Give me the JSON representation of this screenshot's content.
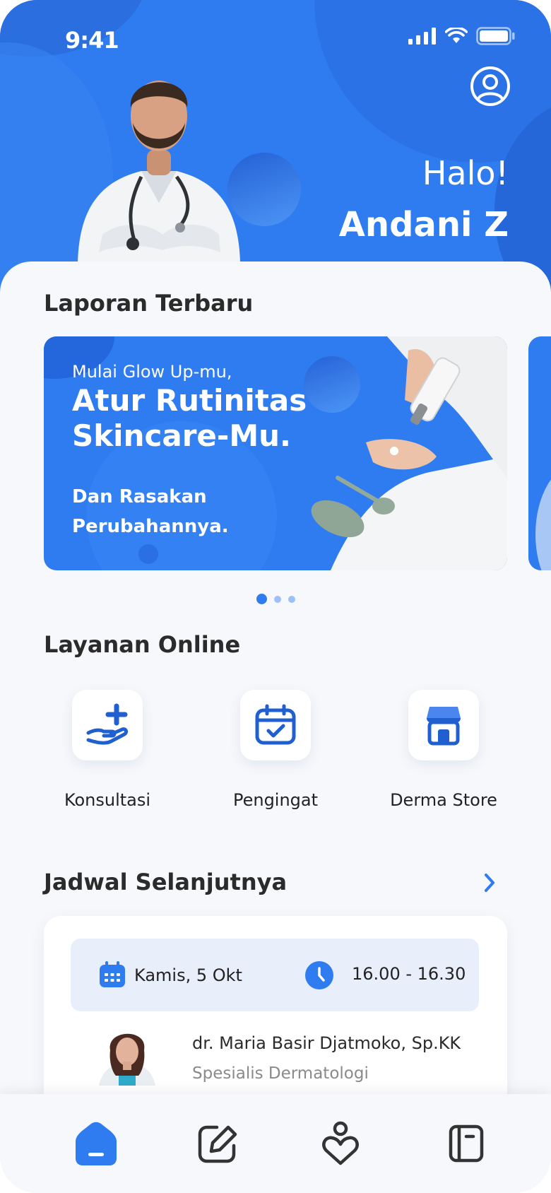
{
  "status_bar": {
    "time": "9:41"
  },
  "header": {
    "greeting": "Halo!",
    "user_name": "Andani Z"
  },
  "sections": {
    "reports_title": "Laporan Terbaru",
    "services_title": "Layanan Online",
    "schedule_title": "Jadwal Selanjutnya"
  },
  "banner": {
    "kicker": "Mulai Glow Up-mu,",
    "headline": "Atur Rutinitas Skincare-Mu.",
    "subline": "Dan Rasakan Perubahannya.",
    "pages": 3,
    "active_page": 1
  },
  "services": [
    {
      "label": "Konsultasi",
      "icon": "hand-plus-icon"
    },
    {
      "label": "Pengingat",
      "icon": "calendar-check-icon"
    },
    {
      "label": "Derma Store",
      "icon": "store-icon"
    }
  ],
  "schedule": {
    "date": "Kamis, 5 Okt",
    "time": "16.00 - 16.30",
    "doctor_name": "dr. Maria Basir Djatmoko, Sp.KK",
    "doctor_specialty": "Spesialis Dermatologi"
  },
  "nav": [
    {
      "name": "home",
      "icon": "home-icon",
      "active": true
    },
    {
      "name": "notes",
      "icon": "edit-icon",
      "active": false
    },
    {
      "name": "health",
      "icon": "person-heart-icon",
      "active": false
    },
    {
      "name": "journal",
      "icon": "book-icon",
      "active": false
    }
  ],
  "colors": {
    "primary": "#2f7bf0",
    "background": "#f7f8fb",
    "schedule_bg": "#e8effb"
  }
}
